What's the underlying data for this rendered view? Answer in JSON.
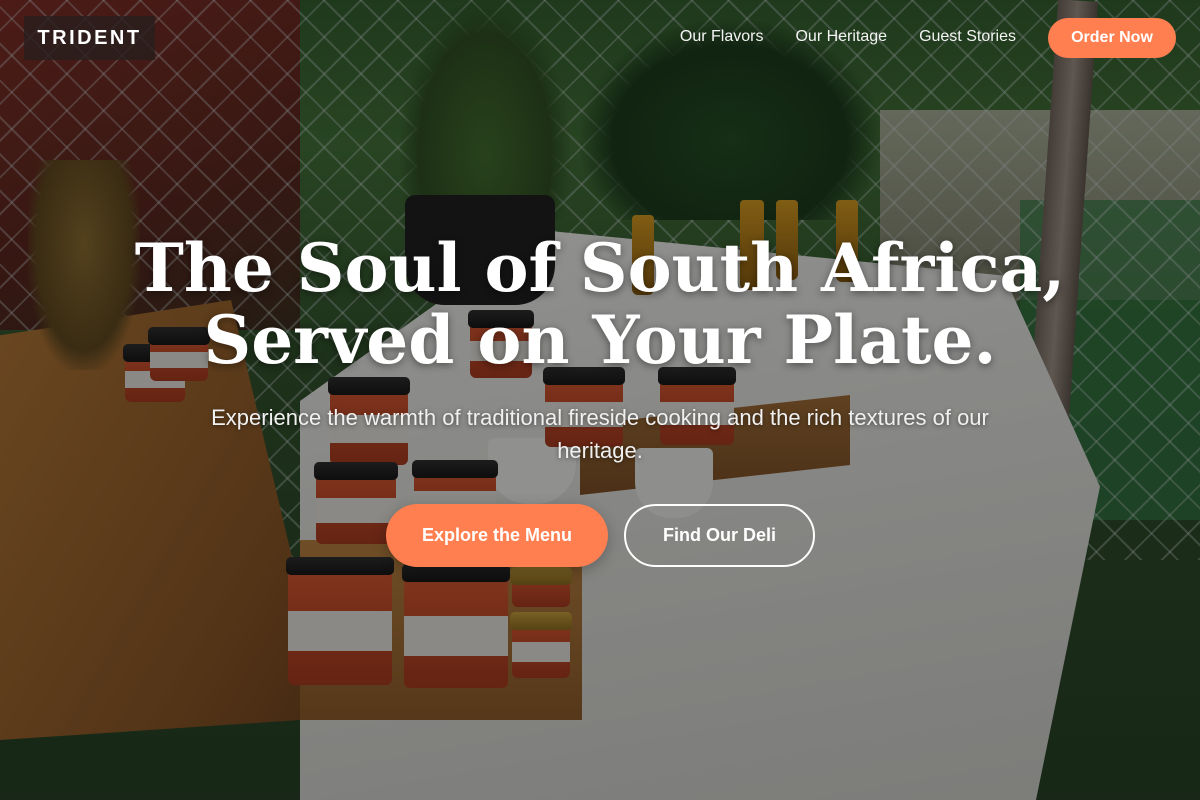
{
  "brand": {
    "logo_text": "TRIDENT"
  },
  "nav": {
    "links": [
      "Our Flavors",
      "Our Heritage",
      "Guest Stories"
    ],
    "cta_label": "Order Now"
  },
  "hero": {
    "title_line1": "The Soul of South Africa,",
    "title_line2": "Served on Your Plate.",
    "subtitle": "Experience the warmth of traditional fireside cooking and the rich textures of our heritage.",
    "primary_button": "Explore the Menu",
    "secondary_button": "Find Our Deli"
  },
  "colors": {
    "accent": "#ff7f50",
    "text": "#ffffff",
    "overlay": "#0a0a0a"
  }
}
